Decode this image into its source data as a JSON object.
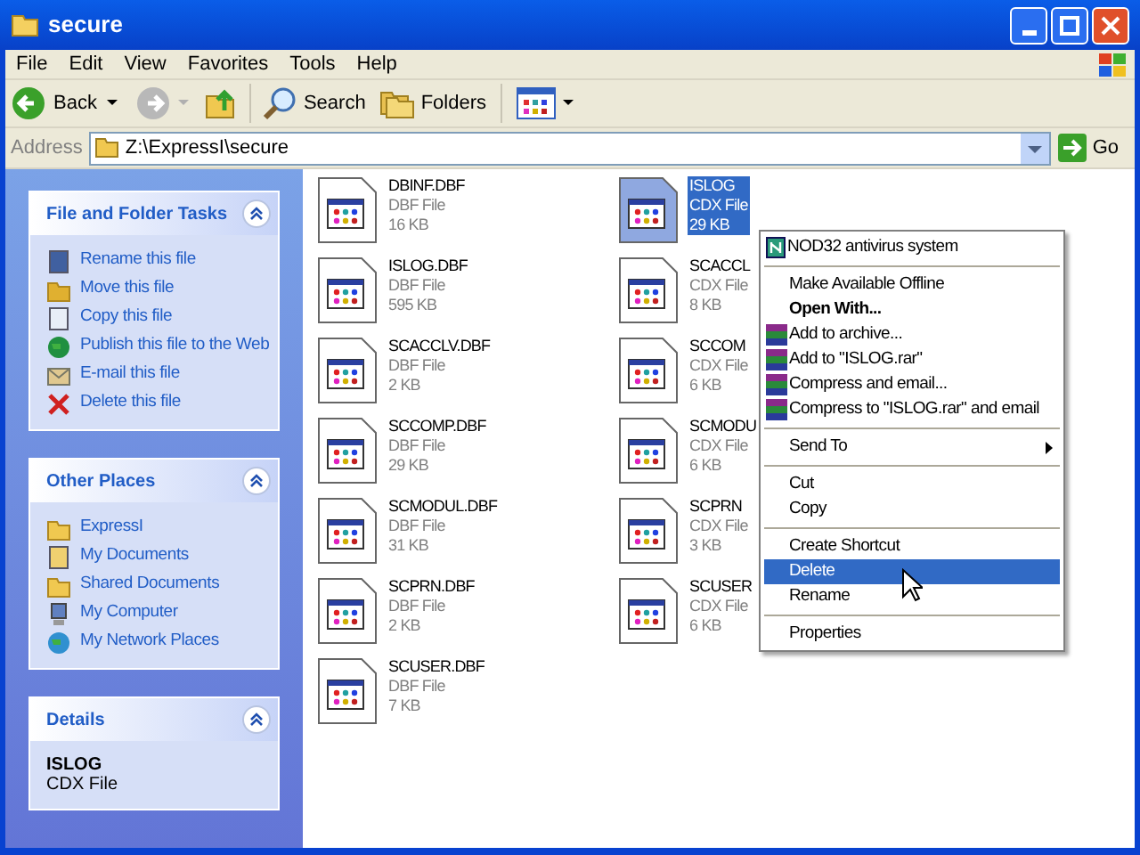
{
  "window": {
    "title": "secure"
  },
  "menu_bar": [
    "File",
    "Edit",
    "View",
    "Favorites",
    "Tools",
    "Help"
  ],
  "toolbar": {
    "back": "Back",
    "search": "Search",
    "folders": "Folders"
  },
  "address": {
    "label": "Address",
    "value": "Z:\\ExpressI\\secure",
    "go": "Go"
  },
  "task_panels": [
    {
      "title": "File and Folder Tasks",
      "items": [
        "Rename this file",
        "Move this file",
        "Copy this file",
        "Publish this file to the Web",
        "E-mail this file",
        "Delete this file"
      ]
    },
    {
      "title": "Other Places",
      "items": [
        "ExpressI",
        "My Documents",
        "Shared Documents",
        "My Computer",
        "My Network Places"
      ]
    }
  ],
  "details": {
    "title": "Details",
    "name": "ISLOG",
    "type": "CDX File"
  },
  "files": [
    {
      "name": "DBINF.DBF",
      "type": "DBF File",
      "size": "16 KB",
      "selected": false
    },
    {
      "name": "ISLOG.DBF",
      "type": "DBF File",
      "size": "595 KB",
      "selected": false
    },
    {
      "name": "SCACCLV.DBF",
      "type": "DBF File",
      "size": "2 KB",
      "selected": false
    },
    {
      "name": "SCCOMP.DBF",
      "type": "DBF File",
      "size": "29 KB",
      "selected": false
    },
    {
      "name": "SCMODUL.DBF",
      "type": "DBF File",
      "size": "31 KB",
      "selected": false
    },
    {
      "name": "SCPRN.DBF",
      "type": "DBF File",
      "size": "2 KB",
      "selected": false
    },
    {
      "name": "SCUSER.DBF",
      "type": "DBF File",
      "size": "7 KB",
      "selected": false
    },
    {
      "name": "ISLOG",
      "type": "CDX File",
      "size": "29 KB",
      "selected": true
    },
    {
      "name": "SCACCL",
      "type": "CDX File",
      "size": "8 KB",
      "selected": false
    },
    {
      "name": "SCCOM",
      "type": "CDX File",
      "size": "6 KB",
      "selected": false
    },
    {
      "name": "SCMODU",
      "type": "CDX File",
      "size": "6 KB",
      "selected": false
    },
    {
      "name": "SCPRN",
      "type": "CDX File",
      "size": "3 KB",
      "selected": false
    },
    {
      "name": "SCUSER",
      "type": "CDX File",
      "size": "6 KB",
      "selected": false
    }
  ],
  "context_menu": [
    {
      "kind": "antivirus",
      "label": "NOD32 antivirus system",
      "selected": false
    },
    {
      "kind": "separator"
    },
    {
      "kind": "item",
      "label": "Make Available Offline",
      "selected": false
    },
    {
      "kind": "default",
      "label": "Open With...",
      "selected": false
    },
    {
      "kind": "archive",
      "label": "Add to archive...",
      "selected": false
    },
    {
      "kind": "archive",
      "label": "Add to \"ISLOG.rar\"",
      "selected": false
    },
    {
      "kind": "archive",
      "label": "Compress and email...",
      "selected": false
    },
    {
      "kind": "archive",
      "label": "Compress to \"ISLOG.rar\" and email",
      "selected": false
    },
    {
      "kind": "separator"
    },
    {
      "kind": "submenu",
      "label": "Send To",
      "selected": false
    },
    {
      "kind": "separator"
    },
    {
      "kind": "item",
      "label": "Cut",
      "selected": false
    },
    {
      "kind": "item",
      "label": "Copy",
      "selected": false
    },
    {
      "kind": "separator"
    },
    {
      "kind": "item",
      "label": "Create Shortcut",
      "selected": false
    },
    {
      "kind": "item",
      "label": "Delete",
      "selected": true
    },
    {
      "kind": "item",
      "label": "Rename",
      "selected": false
    },
    {
      "kind": "separator"
    },
    {
      "kind": "item",
      "label": "Properties",
      "selected": false
    }
  ]
}
